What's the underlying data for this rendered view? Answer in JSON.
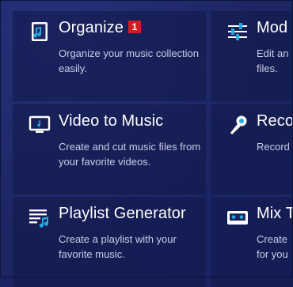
{
  "tiles": [
    {
      "title": "Organize",
      "badge": "1",
      "description": "Organize your music collection easily.",
      "icon": "music-file-icon"
    },
    {
      "title": "Video to Music",
      "description": "Create and cut music files from your favorite videos.",
      "icon": "tv-icon"
    },
    {
      "title": "Playlist Generator",
      "description": "Create a playlist with your favorite music.",
      "icon": "playlist-icon"
    },
    {
      "title": "Mod",
      "description": "Edit an files.",
      "icon": "sliders-icon"
    },
    {
      "title": "Reco",
      "description": "Record",
      "icon": "microphone-icon"
    },
    {
      "title": "Mix T",
      "description": "Create for you",
      "icon": "cassette-icon"
    }
  ],
  "colors": {
    "accent": "#29a8e0",
    "badge": "#d01d24",
    "background": "#1c2663"
  }
}
